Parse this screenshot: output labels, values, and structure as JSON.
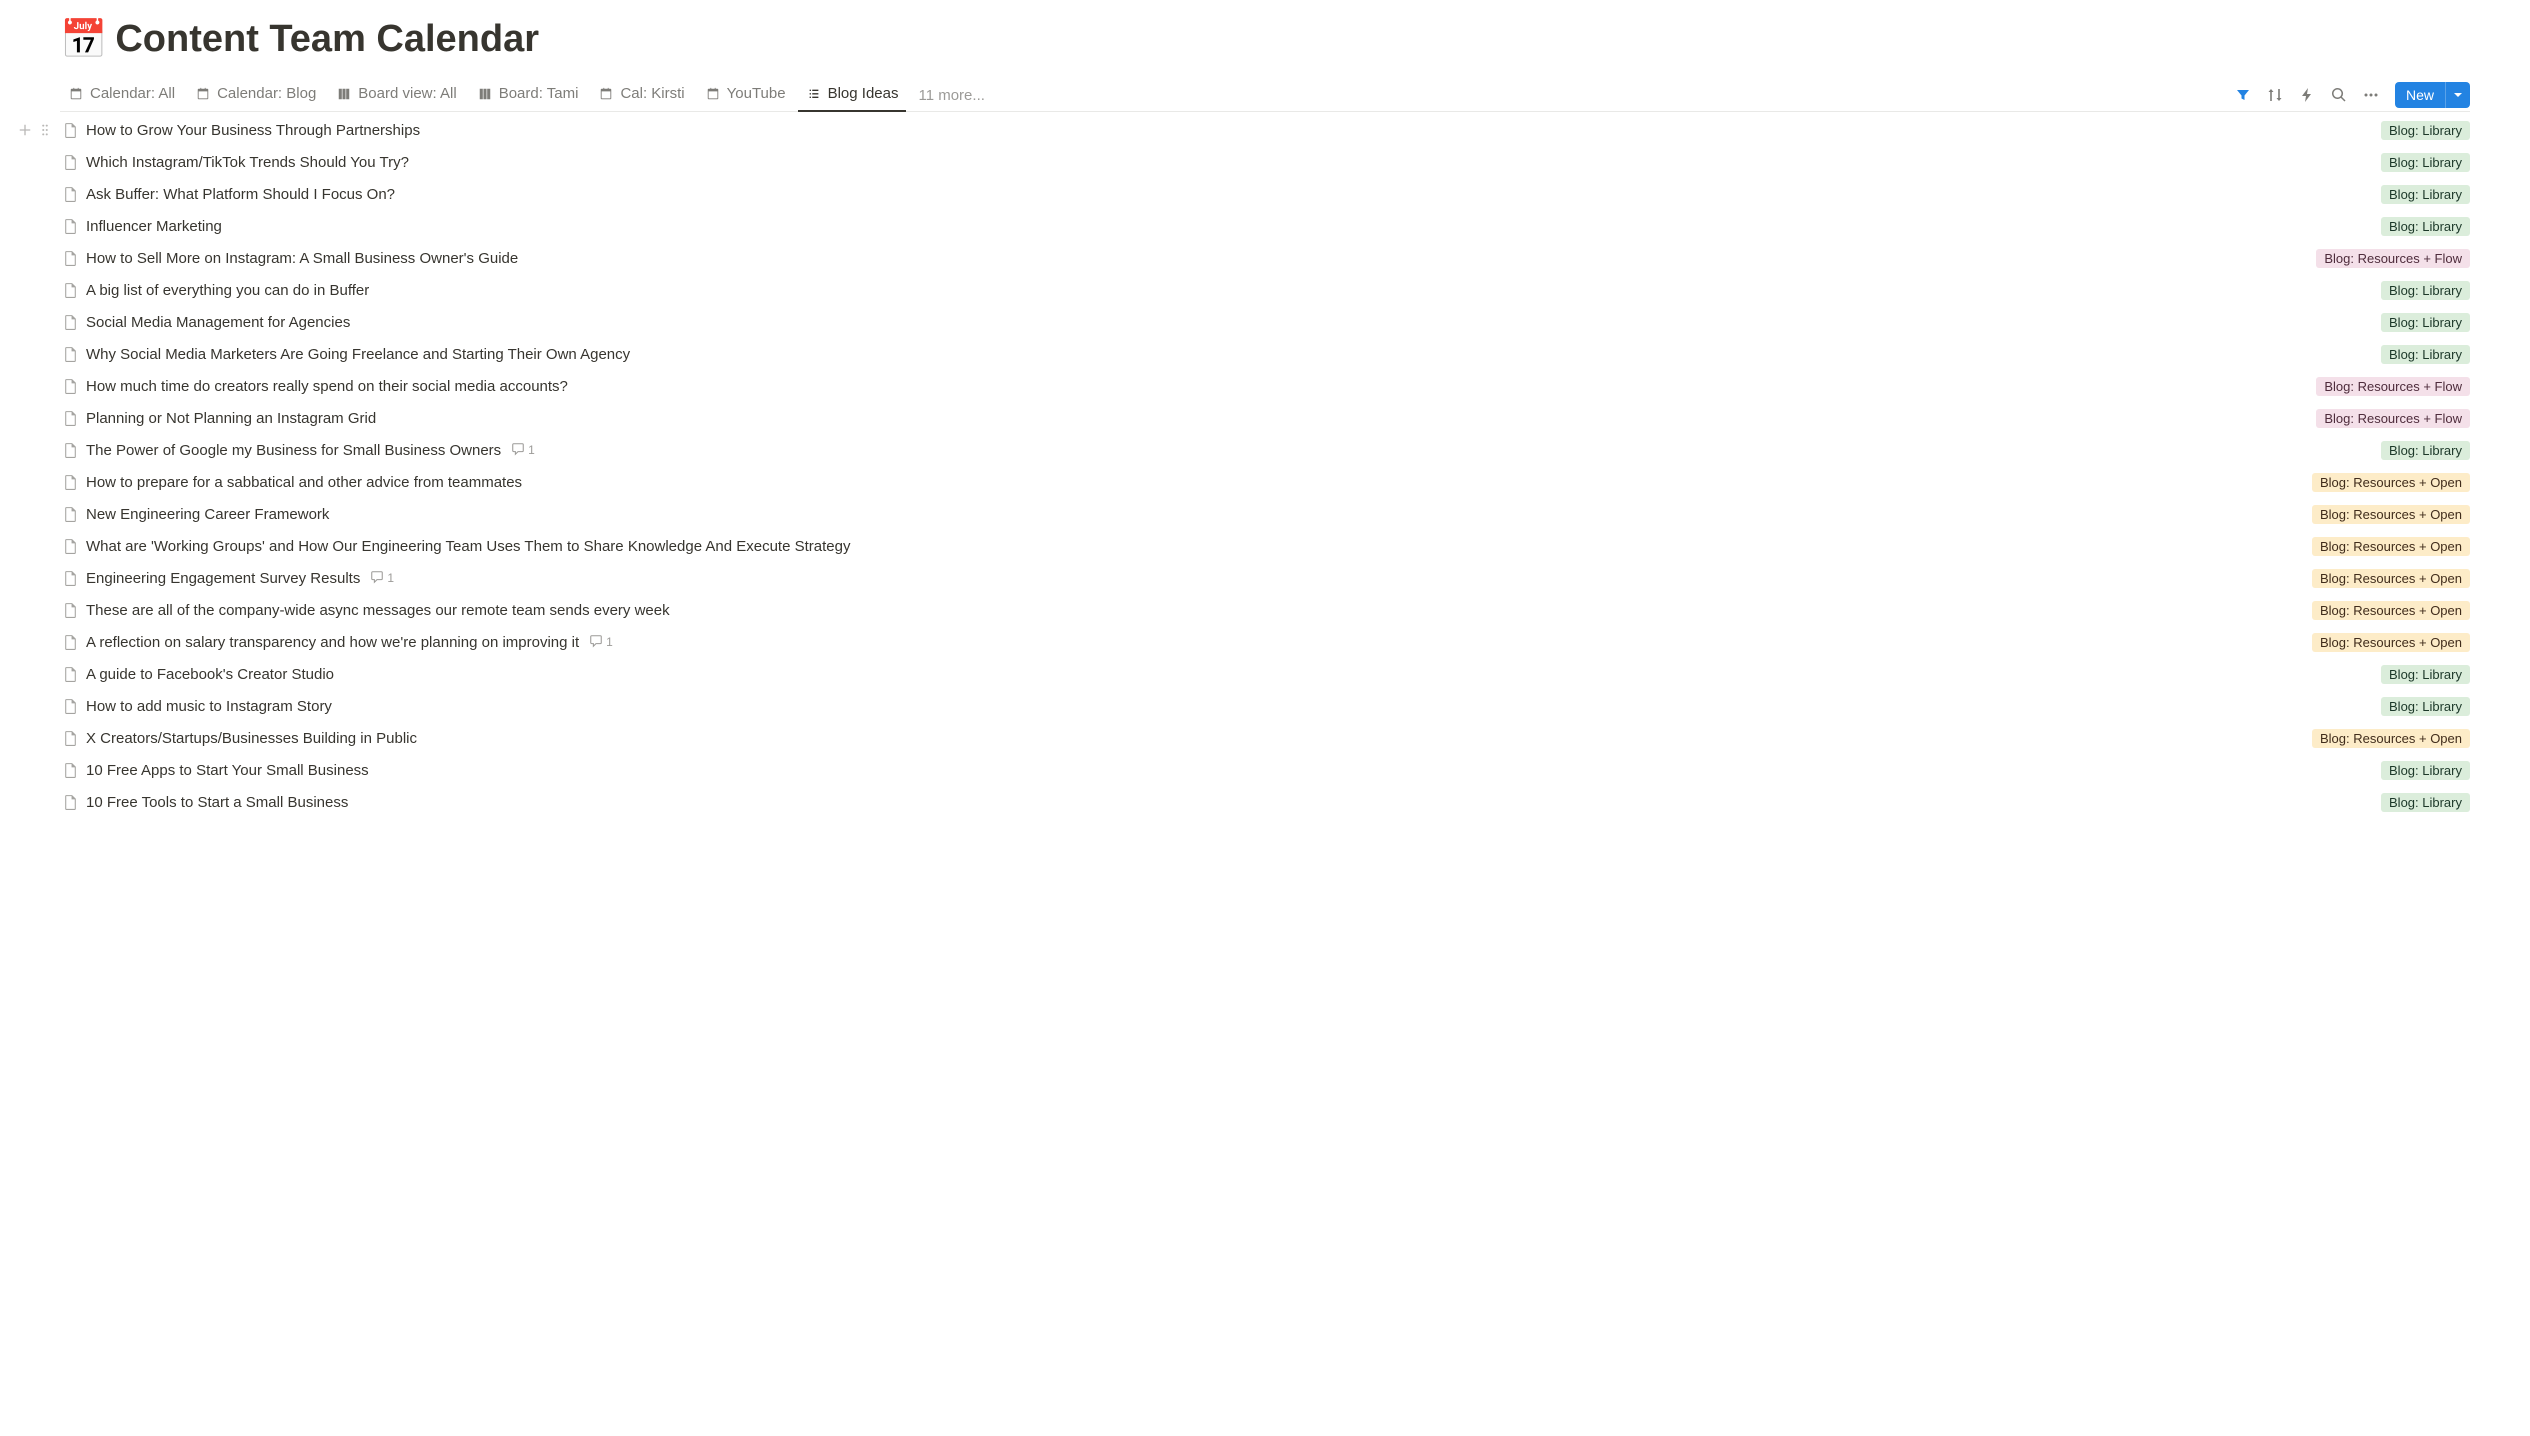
{
  "page_icon": "📅",
  "page_title": "Content Team Calendar",
  "tabs": [
    {
      "icon": "calendar",
      "label": "Calendar: All",
      "active": false
    },
    {
      "icon": "calendar",
      "label": "Calendar: Blog",
      "active": false
    },
    {
      "icon": "board",
      "label": "Board view: All",
      "active": false
    },
    {
      "icon": "board",
      "label": "Board: Tami",
      "active": false
    },
    {
      "icon": "calendar",
      "label": "Cal: Kirsti",
      "active": false
    },
    {
      "icon": "calendar",
      "label": "YouTube",
      "active": false
    },
    {
      "icon": "list",
      "label": "Blog Ideas",
      "active": true
    }
  ],
  "more_views_label": "11 more...",
  "new_button_label": "New",
  "tag_styles": {
    "Blog: Library": "tag-library",
    "Blog: Resources + Flow": "tag-resources-flow",
    "Blog: Resources + Open": "tag-resources-open"
  },
  "rows": [
    {
      "title": "How to Grow Your Business Through Partnerships",
      "tag": "Blog: Library",
      "comments": null
    },
    {
      "title": "Which Instagram/TikTok Trends Should You Try?",
      "tag": "Blog: Library",
      "comments": null
    },
    {
      "title": "Ask Buffer: What Platform Should I Focus On?",
      "tag": "Blog: Library",
      "comments": null
    },
    {
      "title": "Influencer Marketing",
      "tag": "Blog: Library",
      "comments": null
    },
    {
      "title": "How to Sell More on Instagram: A Small Business Owner's Guide",
      "tag": "Blog: Resources + Flow",
      "comments": null
    },
    {
      "title": "A big list of everything you can do in Buffer",
      "tag": "Blog: Library",
      "comments": null
    },
    {
      "title": "Social Media Management for Agencies",
      "tag": "Blog: Library",
      "comments": null
    },
    {
      "title": "Why Social Media Marketers Are Going Freelance and Starting Their Own Agency",
      "tag": "Blog: Library",
      "comments": null
    },
    {
      "title": "How much time do creators really spend on their social media accounts?",
      "tag": "Blog: Resources + Flow",
      "comments": null
    },
    {
      "title": "Planning or Not Planning an Instagram Grid",
      "tag": "Blog: Resources + Flow",
      "comments": null
    },
    {
      "title": "The Power of Google my Business for Small Business Owners",
      "tag": "Blog: Library",
      "comments": 1
    },
    {
      "title": "How to prepare for a sabbatical and other advice from teammates",
      "tag": "Blog: Resources + Open",
      "comments": null
    },
    {
      "title": "New Engineering Career Framework",
      "tag": "Blog: Resources + Open",
      "comments": null
    },
    {
      "title": "What are 'Working Groups' and How Our Engineering Team Uses Them to Share Knowledge And Execute Strategy",
      "tag": "Blog: Resources + Open",
      "comments": null
    },
    {
      "title": "Engineering Engagement Survey Results",
      "tag": "Blog: Resources + Open",
      "comments": 1
    },
    {
      "title": "These are all of the company-wide async messages our remote team sends every week",
      "tag": "Blog: Resources + Open",
      "comments": null
    },
    {
      "title": "A reflection on salary transparency and how we're planning on improving it",
      "tag": "Blog: Resources + Open",
      "comments": 1
    },
    {
      "title": "A guide to Facebook's Creator Studio",
      "tag": "Blog: Library",
      "comments": null
    },
    {
      "title": "How to add music to Instagram Story",
      "tag": "Blog: Library",
      "comments": null
    },
    {
      "title": "X Creators/Startups/Businesses Building in Public",
      "tag": "Blog: Resources + Open",
      "comments": null
    },
    {
      "title": "10 Free Apps to Start Your Small Business",
      "tag": "Blog: Library",
      "comments": null
    },
    {
      "title": "10 Free Tools to Start a Small Business",
      "tag": "Blog: Library",
      "comments": null
    }
  ]
}
